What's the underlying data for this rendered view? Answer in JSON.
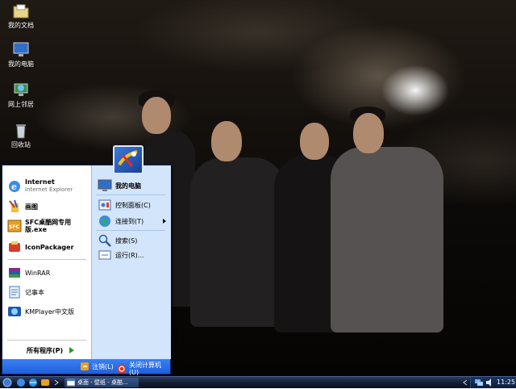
{
  "desktop_icons": [
    {
      "label": "我的文档",
      "icon": "folder-icon"
    },
    {
      "label": "我的电脑",
      "icon": "monitor-icon"
    },
    {
      "label": "网上邻居",
      "icon": "network-icon"
    },
    {
      "label": "回收站",
      "icon": "recycle-bin-icon"
    }
  ],
  "start_menu": {
    "pinned": [
      {
        "title": "Internet",
        "subtitle": "Internet Explorer",
        "icon": "ie-icon"
      },
      {
        "title": "画图",
        "icon": "paint-icon"
      },
      {
        "title": "SFC桌酷网专用版.exe",
        "icon": "sfc-icon"
      },
      {
        "title": "IconPackager",
        "icon": "iconpackager-icon"
      }
    ],
    "recent": [
      {
        "title": "WinRAR",
        "icon": "winrar-icon"
      },
      {
        "title": "记事本",
        "icon": "notepad-icon"
      },
      {
        "title": "KMPlayer中文版",
        "icon": "kmplayer-icon"
      }
    ],
    "all_programs": "所有程序(P)",
    "right": [
      {
        "title": "我的电脑",
        "icon": "monitor-icon"
      },
      {
        "title": "控制面板(C)",
        "icon": "control-panel-icon"
      },
      {
        "title": "连接到(T)",
        "icon": "globe-icon"
      },
      {
        "title": "搜索(S)",
        "icon": "search-icon"
      },
      {
        "title": "运行(R)...",
        "icon": "run-icon"
      }
    ],
    "logoff": "注销(L)",
    "shutdown": "关闭计算机(U)"
  },
  "taskbar": {
    "task_label": "桌面 - 壁纸 - 桌酷...",
    "clock": "11:25"
  },
  "colors": {
    "taskbar": "#10192c",
    "start_menu_right": "#d3e5fa",
    "start_menu_bottom": "#1f5fdc"
  }
}
